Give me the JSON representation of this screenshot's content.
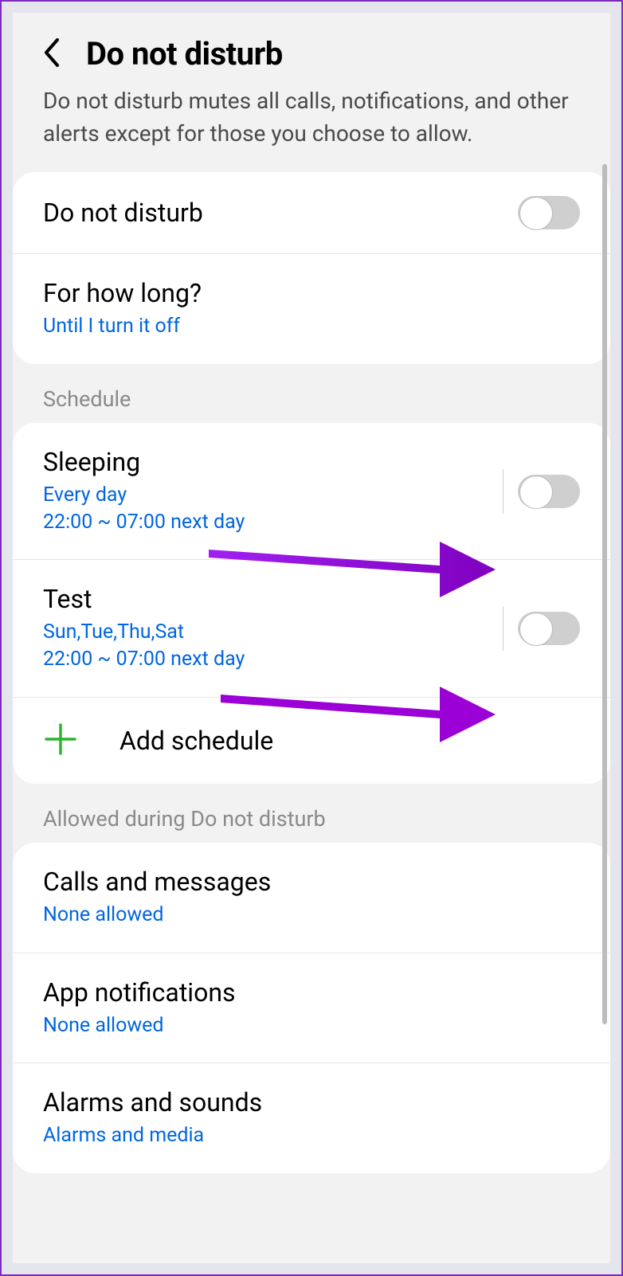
{
  "header": {
    "title": "Do not disturb"
  },
  "description": "Do not disturb mutes all calls, notifications, and other alerts except for those you choose to allow.",
  "main_toggle": {
    "label": "Do not disturb"
  },
  "duration": {
    "label": "For how long?",
    "value": "Until I turn it off"
  },
  "schedule_section": {
    "label": "Schedule",
    "items": [
      {
        "title": "Sleeping",
        "days": "Every day",
        "time": "22:00 ~ 07:00 next day"
      },
      {
        "title": "Test",
        "days": "Sun,Tue,Thu,Sat",
        "time": "22:00 ~ 07:00 next day"
      }
    ],
    "add_label": "Add schedule"
  },
  "allowed_section": {
    "label": "Allowed during Do not disturb",
    "items": [
      {
        "title": "Calls and messages",
        "sub": "None allowed"
      },
      {
        "title": "App notifications",
        "sub": "None allowed"
      },
      {
        "title": "Alarms and sounds",
        "sub": "Alarms and media"
      }
    ]
  },
  "colors": {
    "link": "#0066e0",
    "annotation": "#9b00d6",
    "plus": "#2db52d"
  }
}
